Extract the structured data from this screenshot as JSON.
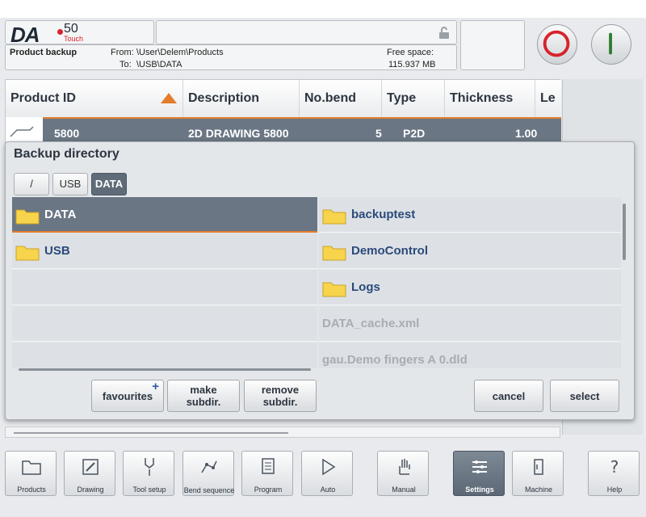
{
  "logo": {
    "brand": "DA",
    "model": "50",
    "touch": "Touch"
  },
  "infobar": {
    "screen_name": "Product backup",
    "from_label": "From:",
    "from_path": "\\User\\Delem\\Products",
    "to_label": "To:",
    "to_path": "\\USB\\DATA",
    "free_space_label": "Free space:",
    "free_space_value": "115.937 MB"
  },
  "table": {
    "columns": [
      "Product ID",
      "Description",
      "No.bend",
      "Type",
      "Thickness",
      "Le"
    ],
    "selected_row": {
      "id": "5800",
      "description": "2D DRAWING 5800",
      "bends": "5",
      "type": "P2D",
      "thickness": "1.00"
    }
  },
  "dialog": {
    "title": "Backup directory",
    "breadcrumb": [
      "/",
      "USB",
      "DATA"
    ],
    "left_items": [
      {
        "name": "DATA",
        "type": "folder",
        "selected": true
      },
      {
        "name": "USB",
        "type": "folder",
        "selected": false
      },
      {
        "name": "",
        "type": "empty"
      },
      {
        "name": "",
        "type": "empty"
      },
      {
        "name": "",
        "type": "empty"
      }
    ],
    "right_items": [
      {
        "name": "backuptest",
        "type": "folder"
      },
      {
        "name": "DemoControl",
        "type": "folder"
      },
      {
        "name": "Logs",
        "type": "folder"
      },
      {
        "name": "DATA_cache.xml",
        "type": "file"
      },
      {
        "name": "gau.Demo fingers A 0.dld",
        "type": "file"
      }
    ],
    "buttons": {
      "favourites": "favourites",
      "favourites_plus": "+",
      "make_subdir_1": "make",
      "make_subdir_2": "subdir.",
      "remove_subdir_1": "remove",
      "remove_subdir_2": "subdir.",
      "cancel": "cancel",
      "select": "select"
    }
  },
  "nav": [
    {
      "label": "Products",
      "icon": "folder-icon"
    },
    {
      "label": "Drawing",
      "icon": "pencil-icon"
    },
    {
      "label": "Tool setup",
      "icon": "tool-icon"
    },
    {
      "label": "Bend sequence",
      "icon": "bend-sequence-icon"
    },
    {
      "label": "Program",
      "icon": "program-icon"
    },
    {
      "label": "Auto",
      "icon": "play-icon"
    },
    {
      "label": "Manual",
      "icon": "hand-icon"
    },
    {
      "label": "Settings",
      "icon": "settings-icon",
      "active": true
    },
    {
      "label": "Machine",
      "icon": "machine-icon"
    },
    {
      "label": "Help",
      "icon": "help-icon"
    }
  ],
  "colors": {
    "accent": "#e57c2c",
    "selected": "#6a7684",
    "stop_red": "#d8222a",
    "start_green": "#2e7d32"
  }
}
